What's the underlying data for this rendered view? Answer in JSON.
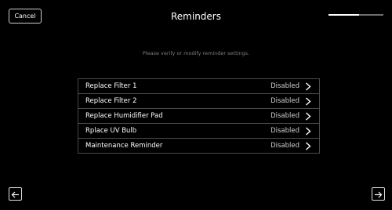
{
  "header": {
    "cancel_label": "Cancel",
    "title": "Reminders",
    "progress_fraction": 0.55
  },
  "subtitle": "Please verify or modify reminder settings.",
  "reminders": [
    {
      "label": "Replace Filter 1",
      "status": "Disabled"
    },
    {
      "label": "Replace Filter 2",
      "status": "Disabled"
    },
    {
      "label": "Replace Humidifier Pad",
      "status": "Disabled"
    },
    {
      "label": "Rplace UV Bulb",
      "status": "Disabled"
    },
    {
      "label": "Maintenance Reminder",
      "status": "Disabled"
    }
  ],
  "icons": {
    "row_chevron": "chevron-right-icon",
    "back": "arrow-left-icon",
    "next": "arrow-right-icon"
  },
  "colors": {
    "background": "#000000",
    "text": "#ffffff",
    "muted_text": "#7d7d7d",
    "border": "#4a4a4a"
  }
}
